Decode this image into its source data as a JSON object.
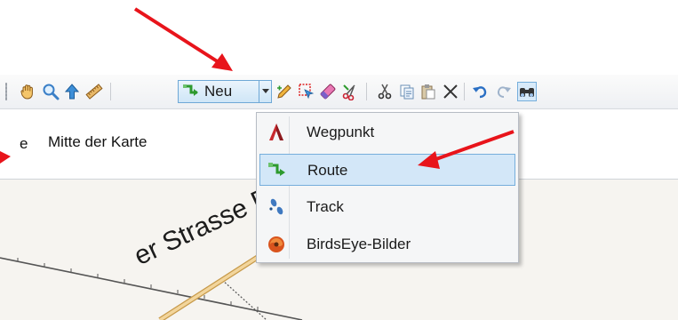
{
  "toolbar": {
    "buttons": [
      {
        "icon": "hand-icon"
      },
      {
        "icon": "zoom-icon"
      },
      {
        "icon": "pointer-arrow-icon"
      },
      {
        "icon": "ruler-icon"
      },
      {
        "icon": "edit-pencil-icon"
      },
      {
        "icon": "select-region-icon"
      },
      {
        "icon": "eraser-icon"
      },
      {
        "icon": "scissors-split-icon"
      },
      {
        "icon": "cut-icon"
      },
      {
        "icon": "copy-icon"
      },
      {
        "icon": "paste-icon"
      },
      {
        "icon": "delete-icon"
      },
      {
        "icon": "undo-icon"
      },
      {
        "icon": "redo-icon"
      },
      {
        "icon": "binoculars-icon"
      }
    ],
    "new_button_label": "Neu"
  },
  "location": {
    "prefix": "e",
    "value": "Mitte der Karte"
  },
  "menu": {
    "items": [
      {
        "label": "Wegpunkt",
        "icon": "waypoint-icon",
        "highlighted": false
      },
      {
        "label": "Route",
        "icon": "route-icon",
        "highlighted": true
      },
      {
        "label": "Track",
        "icon": "track-footsteps-icon",
        "highlighted": false
      },
      {
        "label": "BirdsEye-Bilder",
        "icon": "birdseye-icon",
        "highlighted": false
      }
    ]
  },
  "map": {
    "street_label": "er Strasse Bod"
  },
  "colors": {
    "accent_border": "#76aedc",
    "highlight": "#d3e7f8",
    "annotation_arrow": "#e8141b",
    "road": "#e6c68a"
  }
}
